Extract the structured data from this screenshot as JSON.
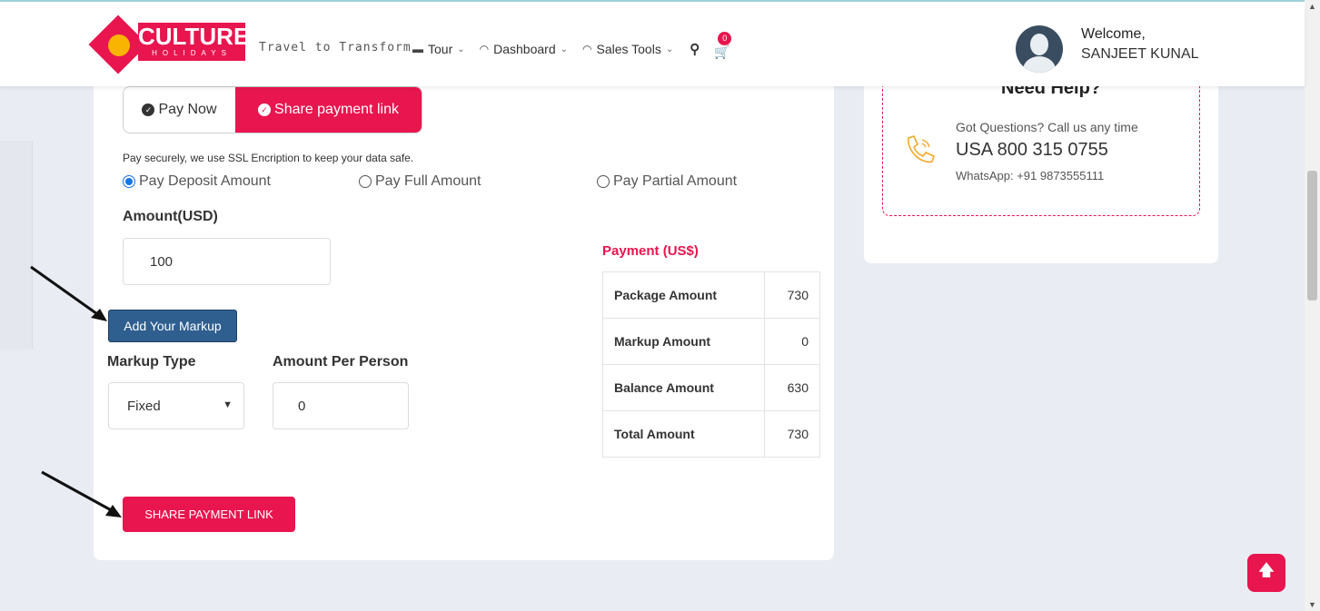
{
  "brand": {
    "logo_word": "CULTURE",
    "logo_sub": "HOLIDAYS",
    "tagline": "Travel to Transform",
    "accent_color": "#e8154f"
  },
  "nav": {
    "items": [
      {
        "label": "Tour",
        "icon": "tour-icon"
      },
      {
        "label": "Dashboard",
        "icon": "dashboard-icon"
      },
      {
        "label": "Sales Tools",
        "icon": "sales-tools-icon"
      }
    ],
    "cart_count": "0"
  },
  "user": {
    "welcome": "Welcome,",
    "name": "SANJEET KUNAL"
  },
  "payment_tabs": {
    "pay_now": "Pay Now",
    "share_link": "Share payment link"
  },
  "secure_note": "Pay securely, we use SSL Encription to keep your data safe.",
  "payment_options": [
    {
      "label": "Pay Deposit Amount",
      "selected": true
    },
    {
      "label": "Pay Full Amount",
      "selected": false
    },
    {
      "label": "Pay Partial Amount",
      "selected": false
    }
  ],
  "amount": {
    "label": "Amount(USD)",
    "value": "100"
  },
  "markup": {
    "button_label": "Add Your Markup",
    "type_label": "Markup Type",
    "type_value": "Fixed",
    "per_person_label": "Amount Per Person",
    "per_person_value": "0"
  },
  "share_button": "SHARE PAYMENT LINK",
  "summary": {
    "title": "Payment (US$)",
    "rows": [
      {
        "label": "Package Amount",
        "value": "730"
      },
      {
        "label": "Markup Amount",
        "value": "0"
      },
      {
        "label": "Balance Amount",
        "value": "630"
      },
      {
        "label": "Total Amount",
        "value": "730"
      }
    ]
  },
  "help": {
    "title": "Need Help?",
    "question": "Got Questions? Call us any time",
    "phone": "USA 800 315 0755",
    "whatsapp": "WhatsApp: +91 9873555111"
  }
}
